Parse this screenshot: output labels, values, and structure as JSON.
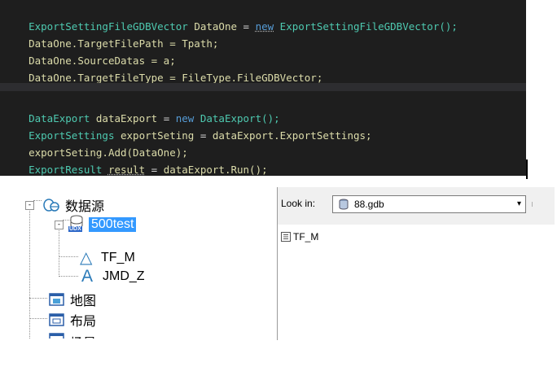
{
  "code_top": {
    "line1": {
      "type": "ExportSettingFileGDBVector",
      "var": "DataOne",
      "op": " = ",
      "kw": "new",
      "ctor": " ExportSettingFileGDBVector();"
    },
    "line2": {
      "obj": "DataOne",
      "rest": ".TargetFilePath = Tpath;"
    },
    "line3": {
      "obj": "DataOne",
      "rest": ".SourceDatas = a;"
    },
    "line4": {
      "obj": "DataOne",
      "rest": ".TargetFileType = FileType.FileGDBVector;"
    }
  },
  "code_bottom": {
    "line1": {
      "type": "DataExport",
      "var": "dataExport",
      "op": " = ",
      "kw": "new",
      "ctor": " DataExport();"
    },
    "line2": {
      "type": "ExportSettings",
      "var": "exportSeting",
      "op": " = ",
      "rest": "dataExport.ExportSettings;"
    },
    "line3": {
      "obj": "exportSeting",
      "rest": ".Add(DataOne);"
    },
    "line4": {
      "type": "ExportResult",
      "var": "result",
      "op": " = ",
      "rest": "dataExport.Run();"
    }
  },
  "tree": {
    "datasource_label": "数据源",
    "datasource_expander": "-",
    "db_label": "500test",
    "db_badge": "UDX",
    "db_expander": "-",
    "children": [
      "TF_M",
      "JMD_Z"
    ],
    "child_glyphs": [
      "△",
      "A"
    ],
    "siblings": [
      "地图",
      "布局",
      "场景"
    ]
  },
  "dialog": {
    "lookin_label": "Look in:",
    "lookin_value": "88.gdb",
    "arrow": "▾",
    "files": [
      "TF_M"
    ]
  },
  "colors": {
    "editor_bg": "#1e1e1e",
    "type": "#4ec9b0",
    "variable": "#dcdcaa",
    "keyword": "#569cd6",
    "selection": "#3399ff"
  }
}
